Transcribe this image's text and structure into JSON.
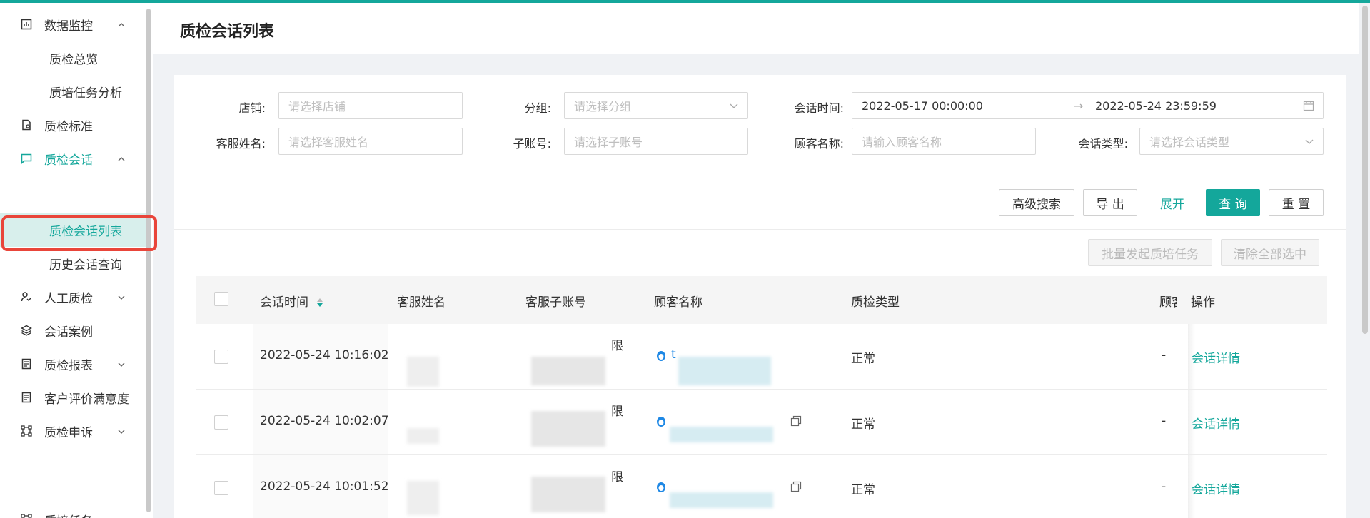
{
  "sidebar": {
    "items": [
      {
        "label": "数据监控"
      },
      {
        "label": "质检总览"
      },
      {
        "label": "质培任务分析"
      },
      {
        "label": "质检标准"
      },
      {
        "label": "质检会话"
      },
      {
        "label": "质检会话列表"
      },
      {
        "label": "历史会话查询"
      },
      {
        "label": "人工质检"
      },
      {
        "label": "会话案例"
      },
      {
        "label": "质检报表"
      },
      {
        "label": "客户评价满意度"
      },
      {
        "label": "质检申诉"
      },
      {
        "label": "质培任务"
      }
    ]
  },
  "header": {
    "title": "质检会话列表"
  },
  "filters": {
    "shop": {
      "label": "店铺:",
      "placeholder": "请选择店铺"
    },
    "group": {
      "label": "分组:",
      "placeholder": "请选择分组"
    },
    "session_time": {
      "label": "会话时间:",
      "start": "2022-05-17 00:00:00",
      "separator": "→",
      "end": "2022-05-24 23:59:59"
    },
    "agent_name": {
      "label": "客服姓名:",
      "placeholder": "请选择客服姓名"
    },
    "sub_account": {
      "label": "子账号:",
      "placeholder": "请选择子账号"
    },
    "customer_name": {
      "label": "顾客名称:",
      "placeholder": "请输入顾客名称"
    },
    "session_type": {
      "label": "会话类型:",
      "placeholder": "请选择会话类型"
    }
  },
  "actions": {
    "advanced": "高级搜索",
    "export": "导 出",
    "expand": "展开",
    "query": "查 询",
    "reset": "重 置",
    "batch_task": "批量发起质培任务",
    "clear_selection": "清除全部选中"
  },
  "table": {
    "columns": [
      "会话时间",
      "客服姓名",
      "客服子账号",
      "顾客名称",
      "质检类型",
      "顾客",
      "操作"
    ],
    "rows": [
      {
        "time": "2022-05-24 10:16:02",
        "sub_suffix": "限",
        "customer_initial": "t",
        "type": "正常",
        "dash": "-",
        "op": "会话详情"
      },
      {
        "time": "2022-05-24 10:02:07",
        "sub_suffix": "限",
        "customer_initial": "",
        "type": "正常",
        "dash": "-",
        "op": "会话详情"
      },
      {
        "time": "2022-05-24 10:01:52",
        "sub_suffix": "限",
        "customer_initial": "",
        "type": "正常",
        "dash": "-",
        "op": "会话详情"
      }
    ]
  },
  "colors": {
    "accent": "#14a79b",
    "highlight": "#e9453a"
  },
  "icons": [
    "bar-chart-icon",
    "document-icon",
    "chat-icon",
    "user-check-icon",
    "layers-icon",
    "report-icon",
    "flow-icon",
    "chevron-up-icon",
    "chevron-down-icon",
    "calendar-icon",
    "sort-icon",
    "qq-icon",
    "copy-icon"
  ]
}
